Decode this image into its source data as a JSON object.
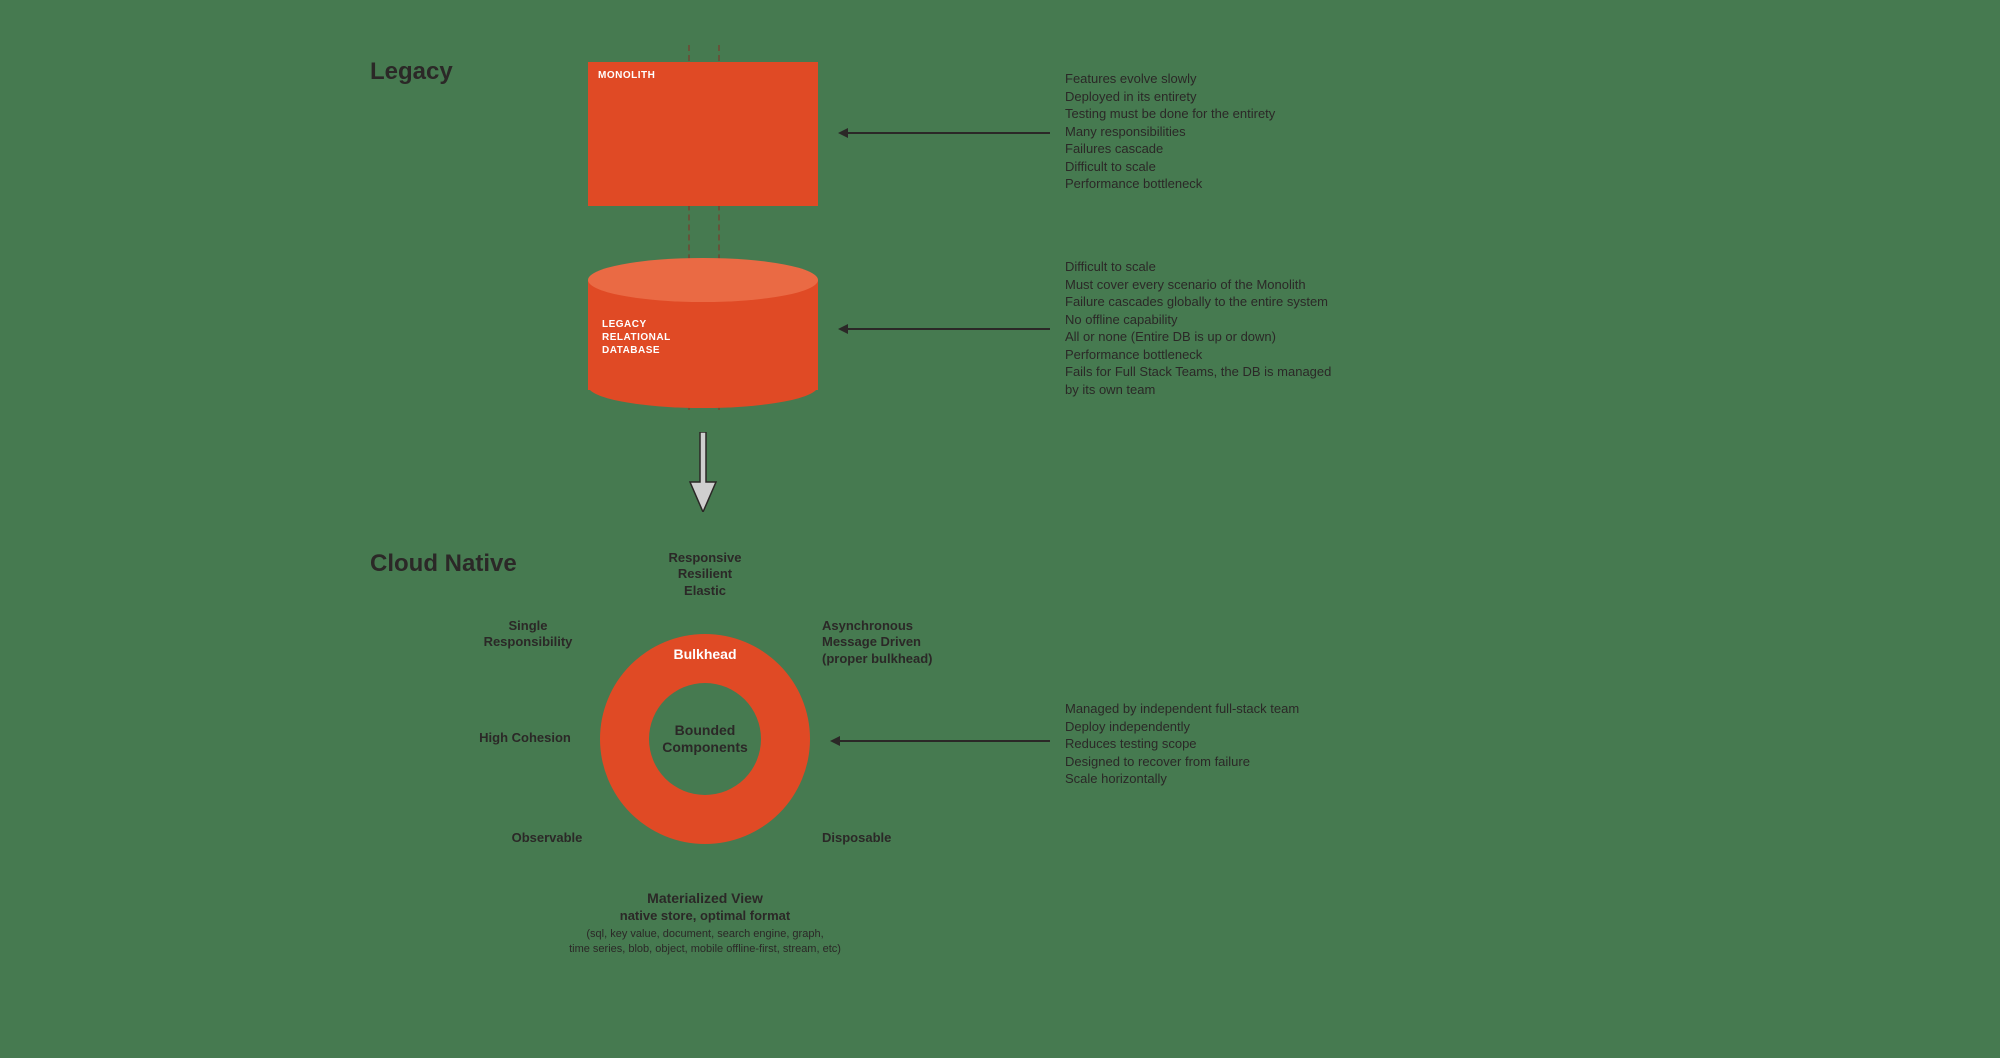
{
  "sections": {
    "legacy_title": "Legacy",
    "cloud_title": "Cloud Native"
  },
  "monolith": {
    "label": "MONOLITH",
    "bullets": [
      "Features evolve slowly",
      "Deployed in its entirety",
      "Testing must be done for the entirety",
      "Many responsibilities",
      "Failures cascade",
      "Difficult to scale",
      "Performance bottleneck"
    ]
  },
  "database": {
    "label_line1": "LEGACY",
    "label_line2": "RELATIONAL",
    "label_line3": "DATABASE",
    "bullets": [
      "Difficult to scale",
      "Must cover every scenario of the Monolith",
      "Failure cascades globally to the entire system",
      "No offline capability",
      "All or none (Entire DB is up or down)",
      "Performance bottleneck",
      "Fails for Full Stack Teams, the DB is managed",
      "by its own team"
    ]
  },
  "ring": {
    "top": "Bulkhead",
    "center_line1": "Bounded",
    "center_line2": "Components",
    "around": {
      "top": [
        "Responsive",
        "Resilient",
        "Elastic"
      ],
      "upper_left": [
        "Single",
        "Responsibility"
      ],
      "upper_right": [
        "Asynchronous",
        "Message Driven",
        "(proper bulkhead)"
      ],
      "mid_left": "High Cohesion",
      "lower_left": "Observable",
      "lower_right": "Disposable"
    },
    "bullets": [
      "Managed by independent full-stack team",
      "Deploy independently",
      "Reduces testing scope",
      "Designed to recover from failure",
      "Scale horizontally"
    ]
  },
  "materialized_view": {
    "title": "Materialized View",
    "subtitle": "native store, optimal format",
    "detail_line1": "(sql, key value, document, search engine, graph,",
    "detail_line2": "time series, blob, object, mobile offline-first, stream, etc)"
  }
}
